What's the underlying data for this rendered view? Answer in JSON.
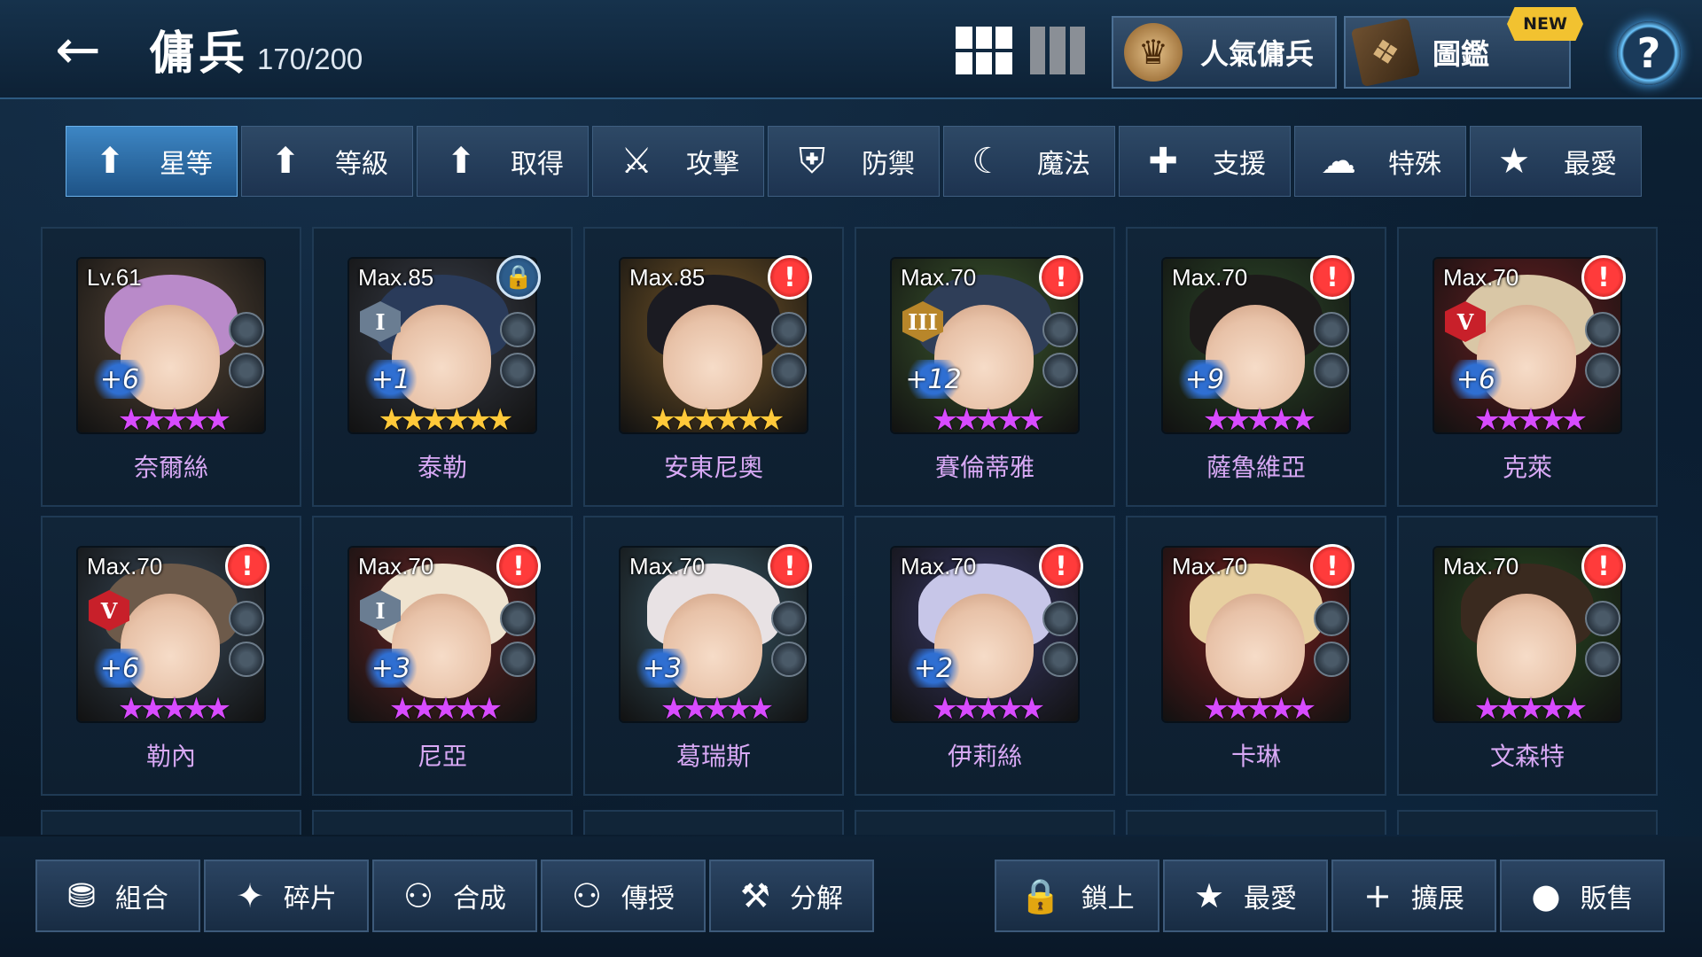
{
  "header": {
    "back_icon": "←",
    "title": "傭兵",
    "count": "170/200",
    "popular_label": "人氣傭兵",
    "book_label": "圖鑑",
    "new_badge": "NEW",
    "help_icon": "?"
  },
  "sort_tabs": [
    {
      "icon": "up-arrow-icon",
      "glyph": "⬆",
      "label": "星等",
      "active": true
    },
    {
      "icon": "up-arrow-icon",
      "glyph": "⬆",
      "label": "等級",
      "active": false
    },
    {
      "icon": "up-arrow-icon",
      "glyph": "⬆",
      "label": "取得",
      "active": false
    },
    {
      "icon": "sword-icon",
      "glyph": "⚔",
      "label": "攻擊",
      "active": false
    },
    {
      "icon": "shield-icon",
      "glyph": "⛨",
      "label": "防禦",
      "active": false
    },
    {
      "icon": "magic-icon",
      "glyph": "☾",
      "label": "魔法",
      "active": false
    },
    {
      "icon": "support-icon",
      "glyph": "✚",
      "label": "支援",
      "active": false
    },
    {
      "icon": "special-icon",
      "glyph": "☁",
      "label": "特殊",
      "active": false
    },
    {
      "icon": "star-icon",
      "glyph": "★",
      "label": "最愛",
      "active": false
    }
  ],
  "mercenaries": [
    {
      "level": "Lv.61",
      "plus": "+6",
      "stars": 5,
      "star_color": "#d84bff",
      "name": "奈爾絲",
      "badge": "none",
      "grade": "",
      "hair": "#b98ac9",
      "bg": "#5b4a3a"
    },
    {
      "level": "Max.85",
      "plus": "+1",
      "stars": 6,
      "star_color": "#ffc93a",
      "name": "泰勒",
      "badge": "lock",
      "grade": "I",
      "hair": "#2a3b5a",
      "bg": "#3a3f4a"
    },
    {
      "level": "Max.85",
      "plus": "",
      "stars": 6,
      "star_color": "#ffc93a",
      "name": "安東尼奧",
      "badge": "alert",
      "grade": "",
      "hair": "#1b1b22",
      "bg": "#7a5a2a"
    },
    {
      "level": "Max.70",
      "plus": "+12",
      "stars": 5,
      "star_color": "#d84bff",
      "name": "賽倫蒂雅",
      "badge": "alert",
      "grade": "III",
      "hair": "#2f3e58",
      "bg": "#3d5a2f"
    },
    {
      "level": "Max.70",
      "plus": "+9",
      "stars": 5,
      "star_color": "#d84bff",
      "name": "薩魯維亞",
      "badge": "alert",
      "grade": "",
      "hair": "#1d1a1a",
      "bg": "#2e4a2a"
    },
    {
      "level": "Max.70",
      "plus": "+6",
      "stars": 5,
      "star_color": "#d84bff",
      "name": "克萊",
      "badge": "alert",
      "grade": "V",
      "hair": "#d9c7a6",
      "bg": "#6a1f22"
    },
    {
      "level": "Max.70",
      "plus": "+6",
      "stars": 5,
      "star_color": "#d84bff",
      "name": "勒內",
      "badge": "alert",
      "grade": "V",
      "hair": "#6d5a4a",
      "bg": "#3a4a5a"
    },
    {
      "level": "Max.70",
      "plus": "+3",
      "stars": 5,
      "star_color": "#d84bff",
      "name": "尼亞",
      "badge": "alert",
      "grade": "I",
      "hair": "#efe3cf",
      "bg": "#6a2626"
    },
    {
      "level": "Max.70",
      "plus": "+3",
      "stars": 5,
      "star_color": "#d84bff",
      "name": "葛瑞斯",
      "badge": "alert",
      "grade": "",
      "hair": "#e8e2e4",
      "bg": "#3a5a6a"
    },
    {
      "level": "Max.70",
      "plus": "+2",
      "stars": 5,
      "star_color": "#d84bff",
      "name": "伊莉絲",
      "badge": "alert",
      "grade": "",
      "hair": "#c7c6e8",
      "bg": "#3a3a6a"
    },
    {
      "level": "Max.70",
      "plus": "",
      "stars": 5,
      "star_color": "#d84bff",
      "name": "卡琳",
      "badge": "alert",
      "grade": "",
      "hair": "#e7cfa0",
      "bg": "#7a1f1f"
    },
    {
      "level": "Max.70",
      "plus": "",
      "stars": 5,
      "star_color": "#d84bff",
      "name": "文森特",
      "badge": "alert",
      "grade": "",
      "hair": "#3a2a1f",
      "bg": "#2a4a22"
    }
  ],
  "bottom_left": [
    {
      "icon": "combo-icon",
      "glyph": "⛃",
      "label": "組合"
    },
    {
      "icon": "shard-icon",
      "glyph": "✦",
      "label": "碎片"
    },
    {
      "icon": "fusion-icon",
      "glyph": "⚇",
      "label": "合成"
    },
    {
      "icon": "transfer-icon",
      "glyph": "⚇",
      "label": "傳授"
    },
    {
      "icon": "disassemble-icon",
      "glyph": "⚒",
      "label": "分解"
    }
  ],
  "bottom_right": [
    {
      "icon": "lock-icon",
      "glyph": "🔒",
      "label": "鎖上"
    },
    {
      "icon": "star-icon",
      "glyph": "★",
      "label": "最愛"
    },
    {
      "icon": "plus-icon",
      "glyph": "+",
      "label": "擴展"
    },
    {
      "icon": "coin-icon",
      "glyph": "●",
      "label": "販售"
    }
  ],
  "colors": {
    "accent": "#3d86c4",
    "name_text": "#d8a9f5",
    "alert": "#ff3b3b"
  }
}
